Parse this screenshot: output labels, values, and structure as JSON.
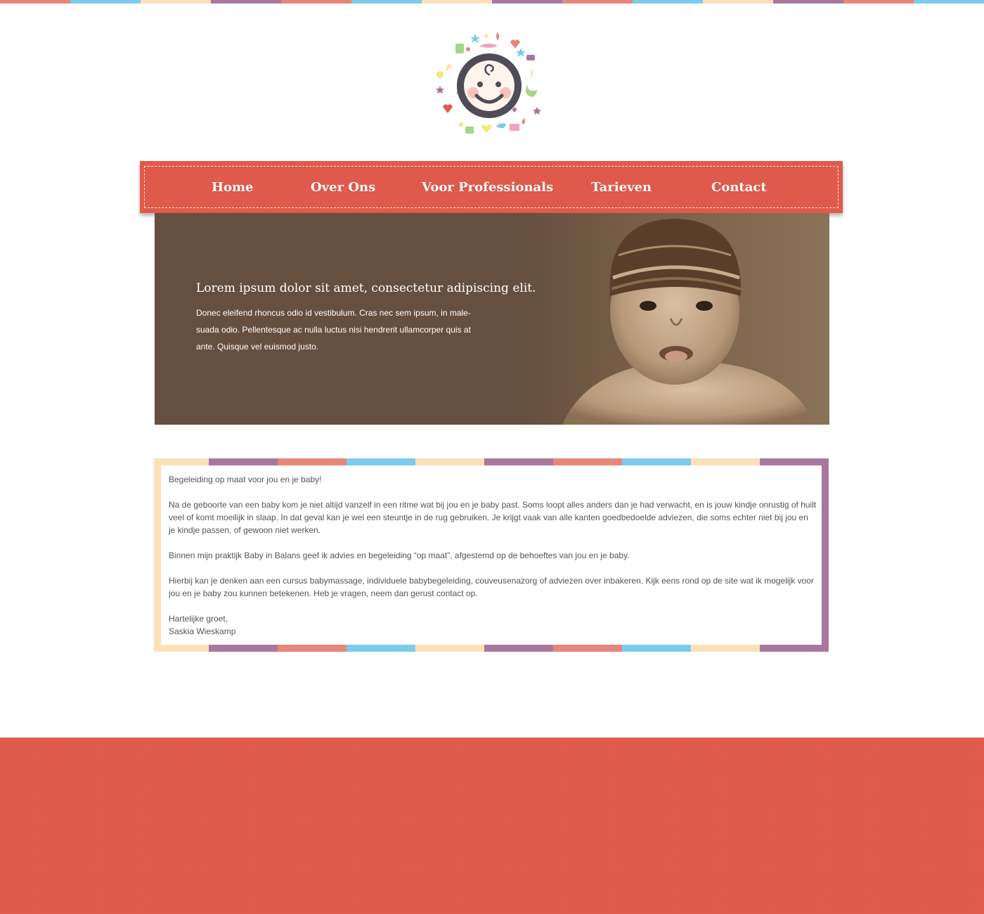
{
  "colors": {
    "accent": "#e05a4b",
    "stripe_coral": "#e8867a",
    "stripe_blue": "#7ccbec",
    "stripe_cream": "#fde0b9",
    "stripe_purple": "#a9779e",
    "hero_bg": "#654f3e",
    "text": "#555555"
  },
  "logo": {
    "icon": "baby-face-logo-icon"
  },
  "nav": {
    "items": [
      {
        "label": "Home"
      },
      {
        "label": "Over Ons"
      },
      {
        "label": "Voor Professionals"
      },
      {
        "label": "Tarieven"
      },
      {
        "label": "Contact"
      }
    ]
  },
  "hero": {
    "title": "Lorem ipsum dolor sit amet, consectetur adipiscing elit.",
    "text": "Donec eleifend rhoncus odio id vestibulum. Cras nec sem ipsum, in male-suada odio. Pellentesque ac nulla luctus nisi hendrerit ullamcorper quis at ante. Quisque vel euismod justo.",
    "image": "baby-in-knit-hat-photo"
  },
  "content": {
    "paragraphs": [
      "Begeleiding op maat voor jou en je baby!",
      "Na de geboorte van een baby kom je niet altijd vanzelf in een ritme wat bij jou en je baby past. Soms loopt alles anders dan je had verwacht, en is jouw kindje onrustig of huilt veel of komt moeilijk in slaap. In dat geval kan je wel een steuntje in de rug gebruiken. Je krijgt vaak van alle kanten goedbedoelde adviezen, die soms echter niet bij jou en je kindje passen, of gewoon niet werken.",
      "Binnen mijn praktijk Baby in Balans geef ik advies en begeleiding “op maat”, afgestemd op de behoeftes van jou en je baby.",
      "Hierbij kan je denken aan een cursus babymassage, individuele babybegeleiding, couveusenazorg of adviezen over inbakeren. Kijk eens rond op de site wat ik mogelijk voor jou en je baby zou kunnen betekenen. Heb je vragen, neem dan gerust contact op."
    ],
    "closing": "Hartelijke groet,",
    "signature": "Saskia Wieskamp"
  }
}
